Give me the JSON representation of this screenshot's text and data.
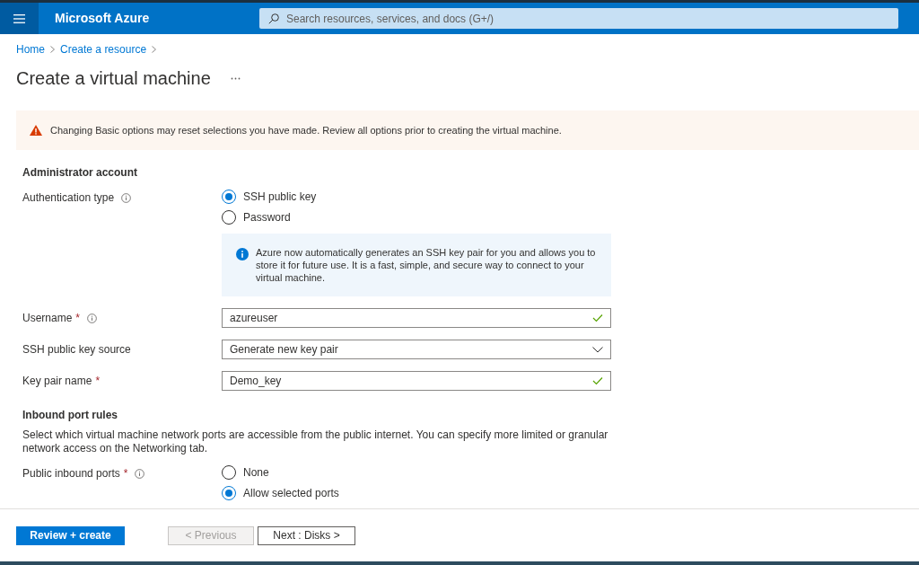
{
  "header": {
    "brand": "Microsoft Azure",
    "search_placeholder": "Search resources, services, and docs (G+/)"
  },
  "breadcrumb": [
    "Home",
    "Create a resource"
  ],
  "title": "Create a virtual machine",
  "warning": "Changing Basic options may reset selections you have made. Review all options prior to creating the virtual machine.",
  "sections": [
    {
      "heading": "Administrator account",
      "fields": [
        {
          "kind": "radio",
          "label": "Authentication type",
          "info": true,
          "options": [
            {
              "label": "SSH public key",
              "selected": true
            },
            {
              "label": "Password",
              "selected": false
            }
          ],
          "note": "Azure now automatically generates an SSH key pair for you and allows you to store it for future use. It is a fast, simple, and secure way to connect to your virtual machine."
        },
        {
          "kind": "textbox",
          "label": "Username",
          "required_mark": "*",
          "info": true,
          "value": "azureuser",
          "valid": true
        },
        {
          "kind": "dropdown",
          "label": "SSH public key source",
          "info": false,
          "value": "Generate new key pair"
        },
        {
          "kind": "textbox",
          "label": "Key pair name",
          "required_mark": "*",
          "info": false,
          "value": "Demo_key",
          "valid": true
        }
      ]
    },
    {
      "heading": "Inbound port rules",
      "description": "Select which virtual machine network ports are accessible from the public internet. You can specify more limited or granular network access on the Networking tab.",
      "fields": [
        {
          "kind": "radio",
          "label": "Public inbound ports",
          "required_mark": "*",
          "info": true,
          "options": [
            {
              "label": "None",
              "selected": false
            },
            {
              "label": "Allow selected ports",
              "selected": true
            }
          ]
        }
      ]
    }
  ],
  "buttons": [
    {
      "label": "Review + create",
      "kind": "primary",
      "disabled": false
    },
    {
      "label": "< Previous",
      "kind": "secondary",
      "disabled": true
    },
    {
      "label": "Next : Disks >",
      "kind": "secondary",
      "disabled": false
    }
  ]
}
